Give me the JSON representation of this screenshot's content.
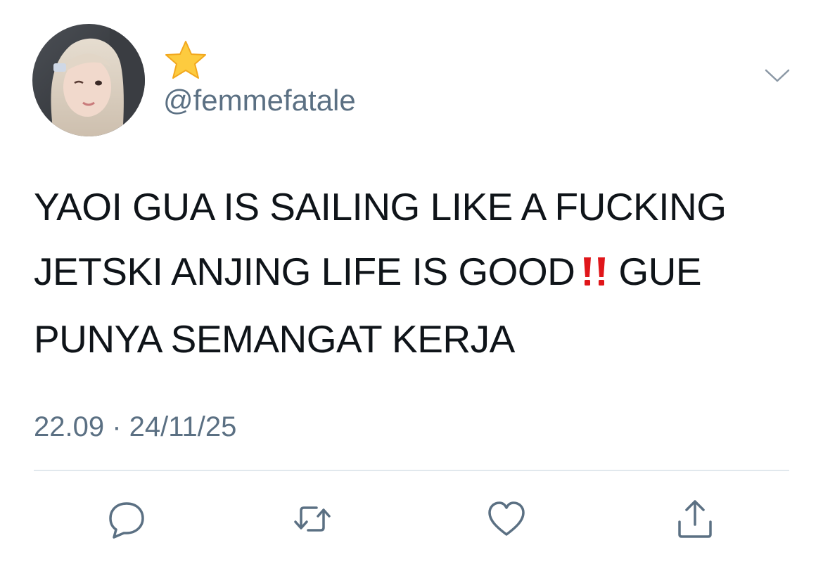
{
  "tweet": {
    "display_name_icon": "star-emoji",
    "handle": "@femmefatale",
    "text_lines": [
      "YAOI GUA IS SAILING LIKE A FUCKING",
      "JETSKI ANJING LIFE IS GOOD",
      "GUE",
      "PUNYA SEMANGAT KERJA"
    ],
    "emphasis_icon": "double-exclamation-emoji",
    "timestamp": "22.09 · 24/11/25"
  },
  "actions": {
    "reply_icon": "reply-bubble-icon",
    "retweet_icon": "retweet-icon",
    "like_icon": "heart-icon",
    "share_icon": "share-icon"
  },
  "colors": {
    "text": "#0f1419",
    "secondary": "#5b7083",
    "divider": "#e1e8ed",
    "star": "#fdcb3f",
    "exclamation": "#e0161a"
  }
}
